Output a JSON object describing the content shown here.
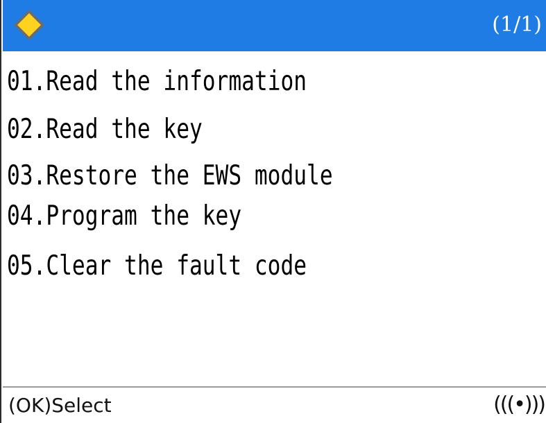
{
  "header": {
    "logo_icon": "yellow-diamond-icon",
    "page_indicator": "(1/1)",
    "background_color": "#1e7ce4"
  },
  "menu": {
    "selected_index": 0,
    "highlight_color": "#ffeb00",
    "items": [
      {
        "label": "01.Read the information"
      },
      {
        "label": "02.Read the key"
      },
      {
        "label": "03.Restore the EWS module"
      },
      {
        "label": "04.Program the key"
      },
      {
        "label": "05.Clear the fault code"
      }
    ]
  },
  "footer": {
    "hint": "(OK)Select",
    "status_icon": "wireless-signal-icon",
    "status_glyph": "(((•)))"
  }
}
